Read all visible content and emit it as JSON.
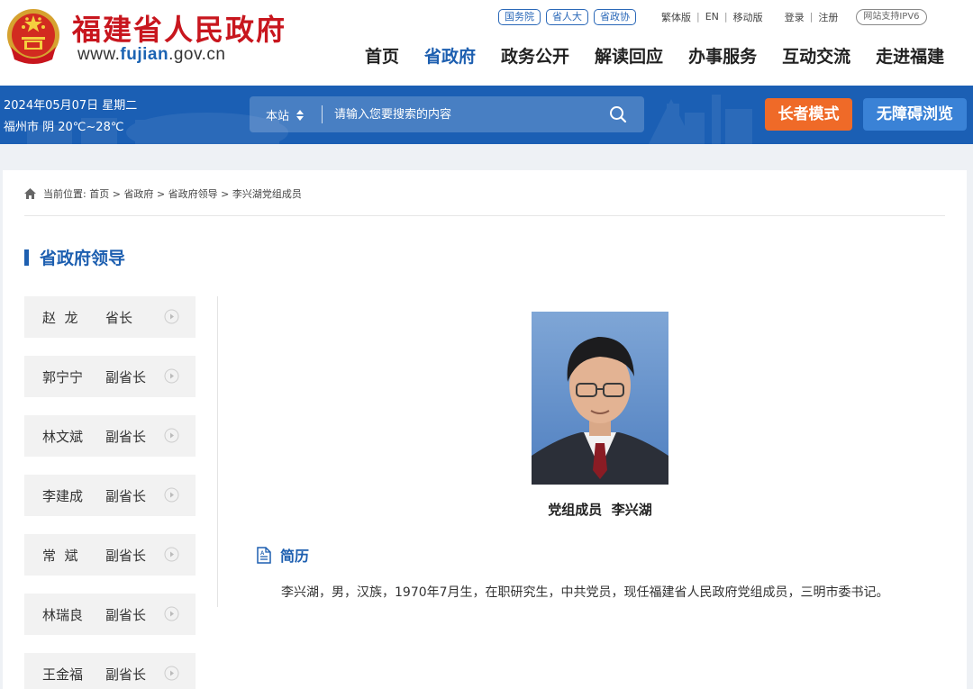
{
  "header": {
    "site_title": "福建省人民政府",
    "url_prefix": "www.",
    "url_highlight": "fujian",
    "url_suffix": ".gov.cn",
    "brand_red": "#c8161e",
    "emblem_icon": "national-emblem-icon"
  },
  "top_links": {
    "pills": [
      "国务院",
      "省人大",
      "省政协"
    ],
    "lang_links": [
      "繁体版",
      "EN",
      "移动版"
    ],
    "separator": "|",
    "account_links": [
      "登录",
      "注册"
    ],
    "ipv6": "网站支持IPV6"
  },
  "nav": {
    "items": [
      "首页",
      "省政府",
      "政务公开",
      "解读回应",
      "办事服务",
      "互动交流",
      "走进福建"
    ],
    "active_index": 1,
    "active_color": "#1d5fb0"
  },
  "bar": {
    "date": "2024年05月07日 星期二",
    "weather": "福州市 阴 20℃~28℃",
    "search_scope": "本站",
    "search_placeholder": "请输入您要搜索的内容",
    "elder_mode": "长者模式",
    "accessible": "无障碍浏览",
    "bar_color": "#1b5fb4",
    "elder_color": "#ef6a28",
    "access_color": "#3a82d6"
  },
  "breadcrumb": {
    "prefix": "当前位置:",
    "items": [
      "首页",
      "省政府",
      "省政府领导",
      "李兴湖党组成员"
    ],
    "separator": ">"
  },
  "section_title": "省政府领导",
  "leaders": [
    {
      "name": "赵  龙",
      "title": "省长"
    },
    {
      "name": "郭宁宁",
      "title": "副省长"
    },
    {
      "name": "林文斌",
      "title": "副省长"
    },
    {
      "name": "李建成",
      "title": "副省长"
    },
    {
      "name": "常  斌",
      "title": "副省长"
    },
    {
      "name": "林瑞良",
      "title": "副省长"
    },
    {
      "name": "王金福",
      "title": "副省长"
    }
  ],
  "profile": {
    "caption": "党组成员  李兴湖",
    "bio_heading": "简历",
    "bio": "李兴湖，男，汉族，1970年7月生，在职研究生，中共党员，现任福建省人民政府党组成员，三明市委书记。"
  }
}
